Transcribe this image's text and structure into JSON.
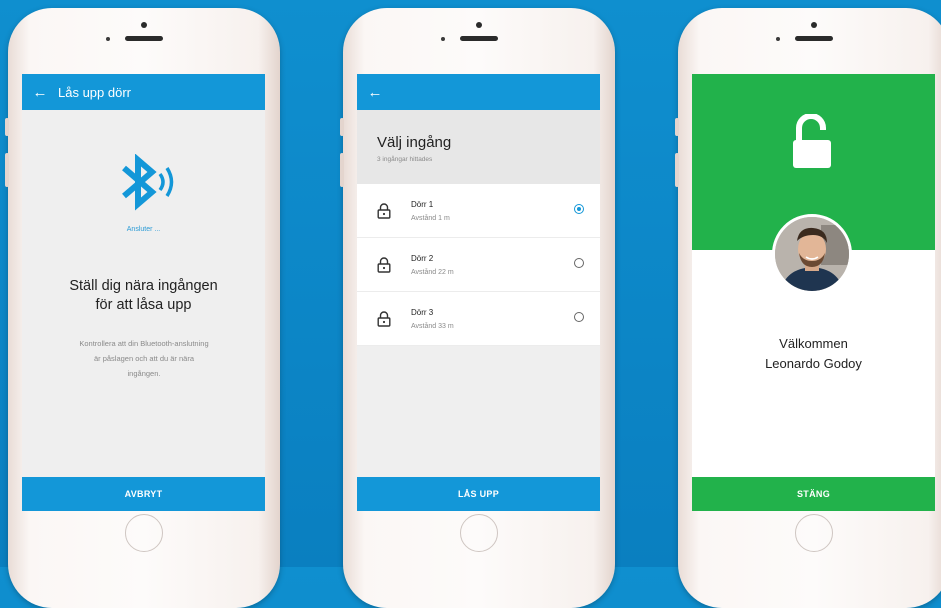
{
  "colors": {
    "background": "#0f8fcf",
    "appbar_blue": "#1397d8",
    "success_green": "#22b24b"
  },
  "screen1": {
    "title": "Lås upp dörr",
    "back_icon": "arrow-left-icon",
    "status": "Ansluter ...",
    "headline_line1": "Ställ dig nära ingången",
    "headline_line2": "för att låsa upp",
    "desc_line1": "Kontrollera att din Bluetooth-anslutning",
    "desc_line2": "är påslagen och att du är nära",
    "desc_line3": "ingången.",
    "button": "AVBRYT"
  },
  "screen2": {
    "back_icon": "arrow-left-icon",
    "title": "Välj ingång",
    "subtitle": "3 ingångar hittades",
    "doors": [
      {
        "name": "Dörr 1",
        "distance": "Avstånd 1 m",
        "selected": true
      },
      {
        "name": "Dörr 2",
        "distance": "Avstånd 22 m",
        "selected": false
      },
      {
        "name": "Dörr 3",
        "distance": "Avstånd 33 m",
        "selected": false
      }
    ],
    "button": "LÅS UPP"
  },
  "screen3": {
    "icon": "unlocked-padlock-icon",
    "welcome": "Välkommen",
    "user_name": "Leonardo Godoy",
    "button": "STÄNG"
  }
}
